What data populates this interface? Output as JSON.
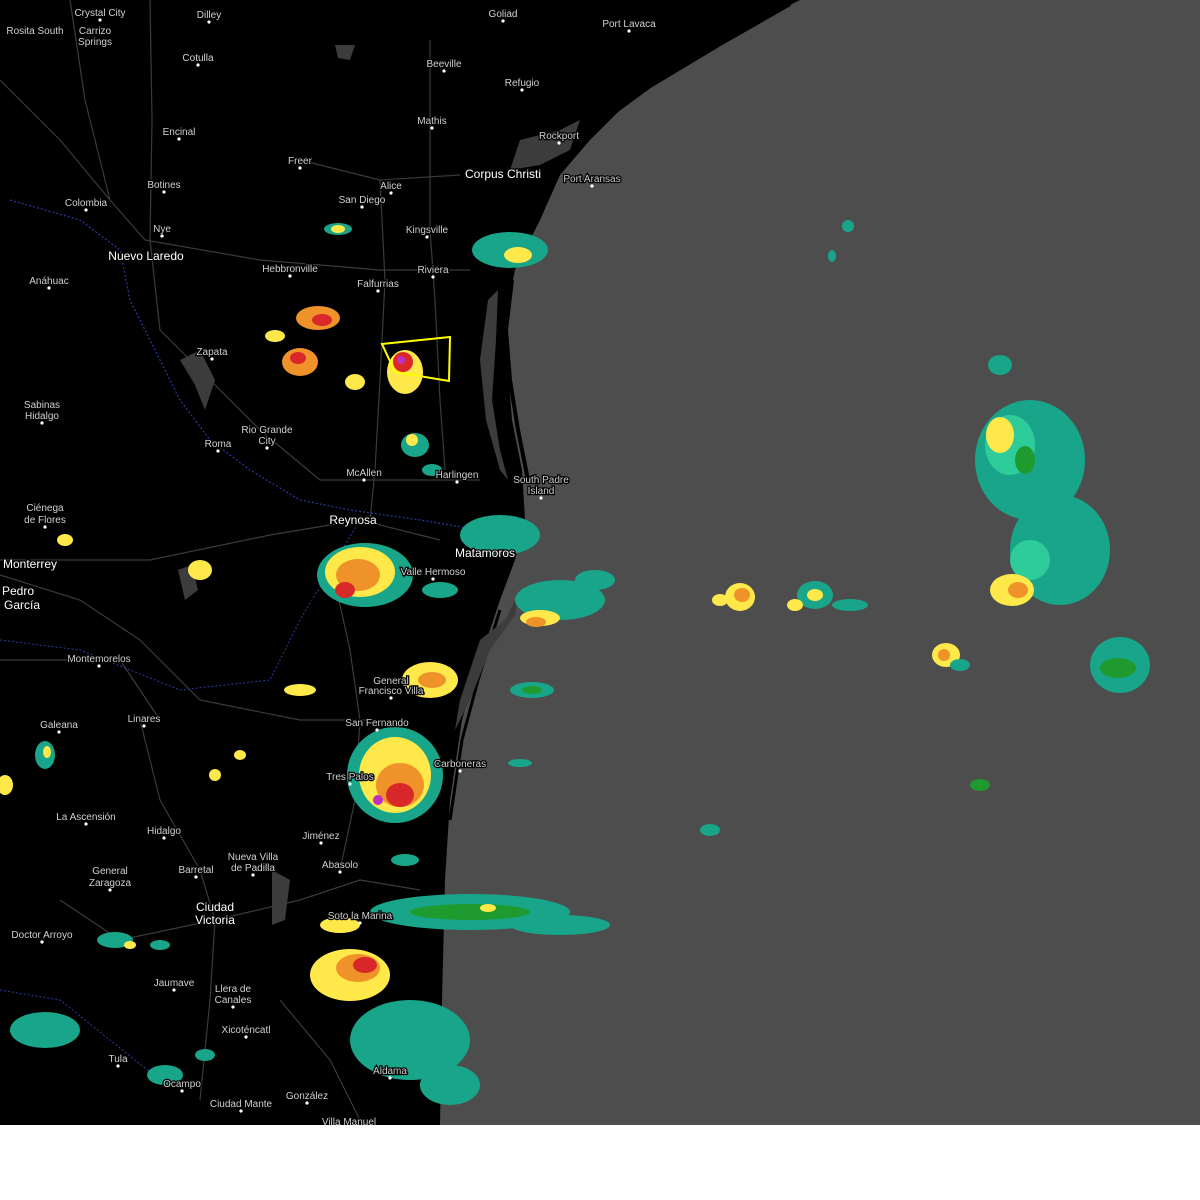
{
  "map": {
    "colors": {
      "land": "#000000",
      "gulf": "#4d4d4d",
      "roads": "#3a3a3a",
      "border": "#2a3aa0",
      "warning_polygon": "#ffff00",
      "radar_light": "#18a58a",
      "radar_mid": "#2ecc9a",
      "radar_green": "#1f9a2f",
      "radar_yellow": "#ffe84a",
      "radar_orange": "#f0922a",
      "radar_red": "#d8282a",
      "radar_magenta": "#c030c0"
    },
    "cities": [
      {
        "name": "Crystal City",
        "major": false
      },
      {
        "name": "Dilley",
        "major": false
      },
      {
        "name": "Goliad",
        "major": false
      },
      {
        "name": "Port Lavaca",
        "major": false
      },
      {
        "name": "Rosita South",
        "major": false
      },
      {
        "name": "Carrizo",
        "major": false
      },
      {
        "name": "Springs",
        "major": false
      },
      {
        "name": "Cotulla",
        "major": false
      },
      {
        "name": "Beeville",
        "major": false
      },
      {
        "name": "Refugio",
        "major": false
      },
      {
        "name": "Mathis",
        "major": false
      },
      {
        "name": "Encinal",
        "major": false
      },
      {
        "name": "Rockport",
        "major": false
      },
      {
        "name": "Freer",
        "major": false
      },
      {
        "name": "Corpus Christi",
        "major": true
      },
      {
        "name": "Port Aransas",
        "major": false
      },
      {
        "name": "Botines",
        "major": false
      },
      {
        "name": "Alice",
        "major": false
      },
      {
        "name": "Colombia",
        "major": false
      },
      {
        "name": "San Diego",
        "major": false
      },
      {
        "name": "Nye",
        "major": false
      },
      {
        "name": "Kingsville",
        "major": false
      },
      {
        "name": "Nuevo Laredo",
        "major": true
      },
      {
        "name": "Hebbronville",
        "major": false
      },
      {
        "name": "Riviera",
        "major": false
      },
      {
        "name": "Anáhuac",
        "major": false
      },
      {
        "name": "Falfurrias",
        "major": false
      },
      {
        "name": "Zapata",
        "major": false
      },
      {
        "name": "Sabinas",
        "major": false
      },
      {
        "name": "Hidalgo",
        "major": false
      },
      {
        "name": "Rio Grande",
        "major": false
      },
      {
        "name": "City",
        "major": false
      },
      {
        "name": "Roma",
        "major": false
      },
      {
        "name": "McAllen",
        "major": false
      },
      {
        "name": "Harlingen",
        "major": false
      },
      {
        "name": "South Padre",
        "major": false
      },
      {
        "name": "Island",
        "major": false
      },
      {
        "name": "Ciénega",
        "major": false
      },
      {
        "name": "de Flores",
        "major": false
      },
      {
        "name": "Reynosa",
        "major": true
      },
      {
        "name": "Matamoros",
        "major": true
      },
      {
        "name": "Monterrey",
        "major": true
      },
      {
        "name": "Valle Hermoso",
        "major": false
      },
      {
        "name": "Pedro",
        "major": true
      },
      {
        "name": "García",
        "major": true
      },
      {
        "name": "Montemorelos",
        "major": false
      },
      {
        "name": "General",
        "major": false
      },
      {
        "name": "Francisco Villa",
        "major": false
      },
      {
        "name": "Galeana",
        "major": false
      },
      {
        "name": "Linares",
        "major": false
      },
      {
        "name": "San Fernando",
        "major": false
      },
      {
        "name": "Tres Palos",
        "major": false
      },
      {
        "name": "Carboneras",
        "major": false
      },
      {
        "name": "La Ascensión",
        "major": false
      },
      {
        "name": "Hidalgo",
        "major": false
      },
      {
        "name": "Jiménez",
        "major": false
      },
      {
        "name": "Barretal",
        "major": false
      },
      {
        "name": "Nueva Villa",
        "major": false
      },
      {
        "name": "de Padilla",
        "major": false
      },
      {
        "name": "Abasolo",
        "major": false
      },
      {
        "name": "General",
        "major": false
      },
      {
        "name": "Zaragoza",
        "major": false
      },
      {
        "name": "Ciudad",
        "major": true
      },
      {
        "name": "Victoria",
        "major": true
      },
      {
        "name": "Soto la Marina",
        "major": false
      },
      {
        "name": "Doctor Arroyo",
        "major": false
      },
      {
        "name": "Jaumave",
        "major": false
      },
      {
        "name": "Llera de",
        "major": false
      },
      {
        "name": "Canales",
        "major": false
      },
      {
        "name": "Xicoténcatl",
        "major": false
      },
      {
        "name": "Tula",
        "major": false
      },
      {
        "name": "Ocampo",
        "major": false
      },
      {
        "name": "Aldama",
        "major": false
      },
      {
        "name": "Ciudad Mante",
        "major": false
      },
      {
        "name": "González",
        "major": false
      },
      {
        "name": "Villa Manuel",
        "major": false
      }
    ]
  }
}
